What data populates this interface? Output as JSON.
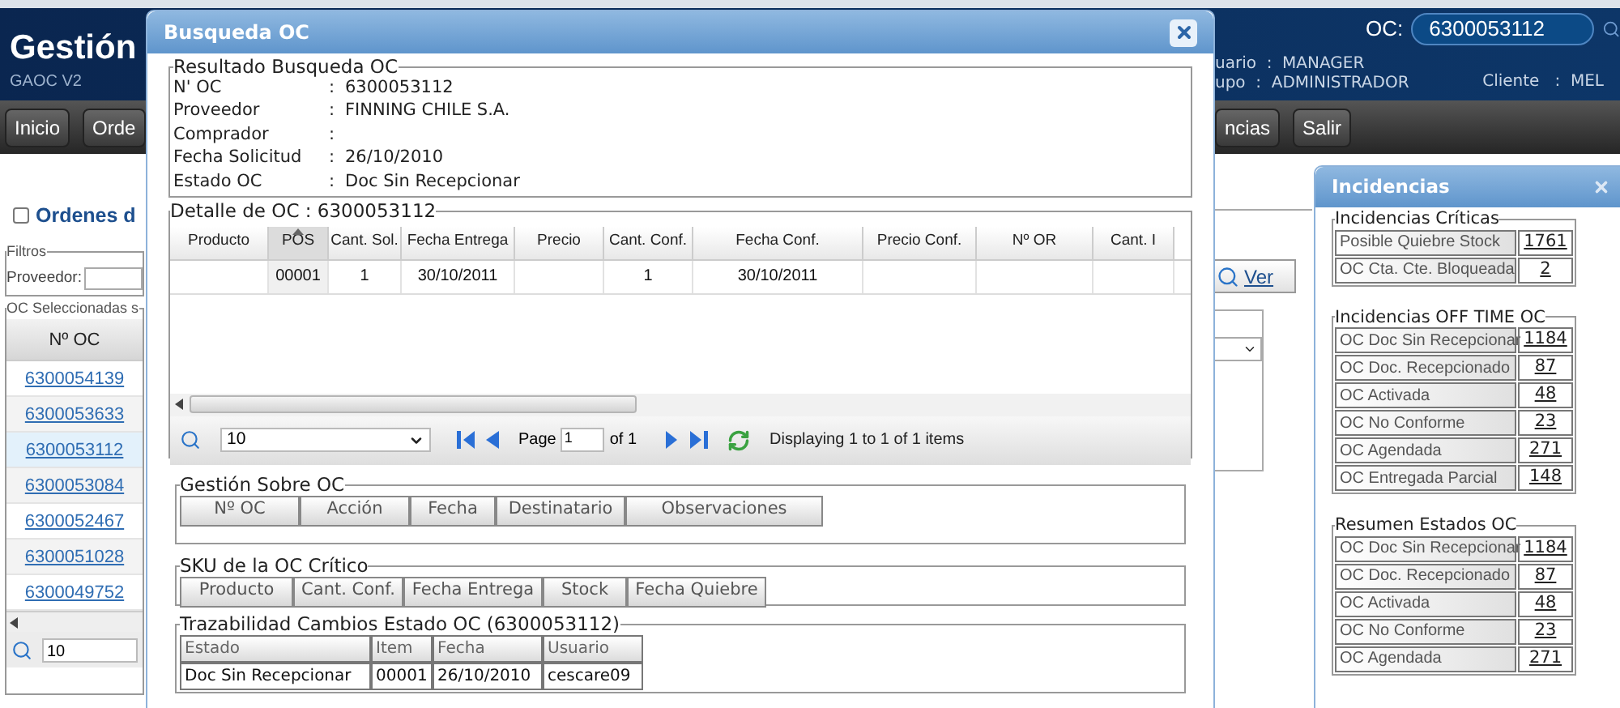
{
  "header": {
    "title": "Gestión",
    "subtitle": "GAOC V2",
    "search_label": "OC:",
    "search_value": "6300053112",
    "user_lines": [
      {
        "label": "uario",
        "separator": ":",
        "value": "MANAGER"
      },
      {
        "label": "upo",
        "separator": ":",
        "value": "ADMINISTRADOR"
      }
    ],
    "client": {
      "label": "Cliente",
      "separator": ":",
      "value": "MEL"
    }
  },
  "nav": {
    "left": [
      "Inicio",
      "Orde"
    ],
    "right": [
      "ncias",
      "Salir"
    ]
  },
  "orders_panel": {
    "title": "Ordenes d",
    "checked": false,
    "filters_legend": "Filtros",
    "provider_label": "Proveedor:",
    "list_legend": "OC Seleccionadas s",
    "column": {
      "label": "Nº OC",
      "sorted": true
    },
    "rows": [
      {
        "oc": "6300054139",
        "selected": false
      },
      {
        "oc": "6300053633",
        "selected": false
      },
      {
        "oc": "6300053112",
        "selected": true
      },
      {
        "oc": "6300053084",
        "selected": false
      },
      {
        "oc": "6300052467",
        "selected": false
      },
      {
        "oc": "6300051028",
        "selected": false
      },
      {
        "oc": "6300049752",
        "selected": false
      }
    ],
    "page_size": "10"
  },
  "side_tools": {
    "view_button": "Ver"
  },
  "search_dialog": {
    "title": "Busqueda OC",
    "result": {
      "legend": "Resultado Busqueda OC",
      "fields": [
        {
          "label": "N' OC",
          "separator": ":",
          "value": "6300053112"
        },
        {
          "label": "Proveedor",
          "separator": ":",
          "value": "FINNING CHILE S.A."
        },
        {
          "label": "Comprador",
          "separator": ":"
        },
        {
          "label": "Fecha Solicitud",
          "separator": ":",
          "value": "26/10/2010"
        },
        {
          "label": "Estado OC",
          "separator": ":",
          "value": "Doc Sin Recepcionar"
        }
      ]
    },
    "detail": {
      "legend": "Detalle de OC : 6300053112",
      "columns": [
        {
          "label": "Producto",
          "sorted": false
        },
        {
          "label": "POS",
          "sorted": true
        },
        {
          "label": "Cant. Sol.",
          "sorted": false
        },
        {
          "label": "Fecha Entrega",
          "sorted": false
        },
        {
          "label": "Precio",
          "sorted": false
        },
        {
          "label": "Cant. Conf.",
          "sorted": false
        },
        {
          "label": "Fecha Conf.",
          "sorted": false
        },
        {
          "label": "Precio Conf.",
          "sorted": false
        },
        {
          "label": "Nº OR",
          "sorted": false
        },
        {
          "label": "Cant. I",
          "sorted": false
        }
      ],
      "rows": [
        [
          {},
          {
            "text": "00001"
          },
          {
            "text": "1"
          },
          {
            "text": "30/10/2011"
          },
          {},
          {
            "text": "1"
          },
          {
            "text": "30/10/2011"
          },
          {},
          {},
          {}
        ]
      ],
      "pager": {
        "page_size": "10",
        "page_label": "Page",
        "page_value": "1",
        "of_label": "of 1",
        "info": "Displaying 1 to 1 of 1 items"
      }
    },
    "management": {
      "legend": "Gestión Sobre OC",
      "columns": [
        "Nº OC",
        "Acción",
        "Fecha",
        "Destinatario",
        "Observaciones"
      ]
    },
    "sku": {
      "legend": "SKU de la OC Crítico",
      "columns": [
        "Producto",
        "Cant. Conf.",
        "Fecha Entrega",
        "Stock",
        "Fecha Quiebre"
      ]
    },
    "trace": {
      "legend": "Trazabilidad Cambios Estado OC (6300053112)",
      "columns": [
        "Estado",
        "Item",
        "Fecha",
        "Usuario"
      ],
      "rows": [
        [
          "Doc Sin Recepcionar",
          "00001",
          "26/10/2010",
          "cescare09"
        ]
      ]
    }
  },
  "incidents_panel": {
    "title": "Incidencias",
    "sections": [
      {
        "title": "Incidencias Críticas",
        "rows": [
          {
            "label": "Posible Quiebre Stock",
            "count": "1761"
          },
          {
            "label": "OC Cta. Cte. Bloqueada",
            "count": "2"
          }
        ]
      },
      {
        "title": "Incidencias OFF TIME OC",
        "rows": [
          {
            "label": "OC Doc Sin Recepcionar",
            "count": "1184"
          },
          {
            "label": "OC Doc. Recepcionado",
            "count": "87"
          },
          {
            "label": "OC Activada",
            "count": "48"
          },
          {
            "label": "OC No Conforme",
            "count": "23"
          },
          {
            "label": "OC Agendada",
            "count": "271"
          },
          {
            "label": "OC Entregada Parcial",
            "count": "148"
          }
        ]
      },
      {
        "title": "Resumen Estados OC",
        "rows": [
          {
            "label": "OC Doc Sin Recepcionar",
            "count": "1184"
          },
          {
            "label": "OC Doc. Recepcionado",
            "count": "87"
          },
          {
            "label": "OC Activada",
            "count": "48"
          },
          {
            "label": "OC No Conforme",
            "count": "23"
          },
          {
            "label": "OC Agendada",
            "count": "271"
          }
        ]
      }
    ]
  }
}
